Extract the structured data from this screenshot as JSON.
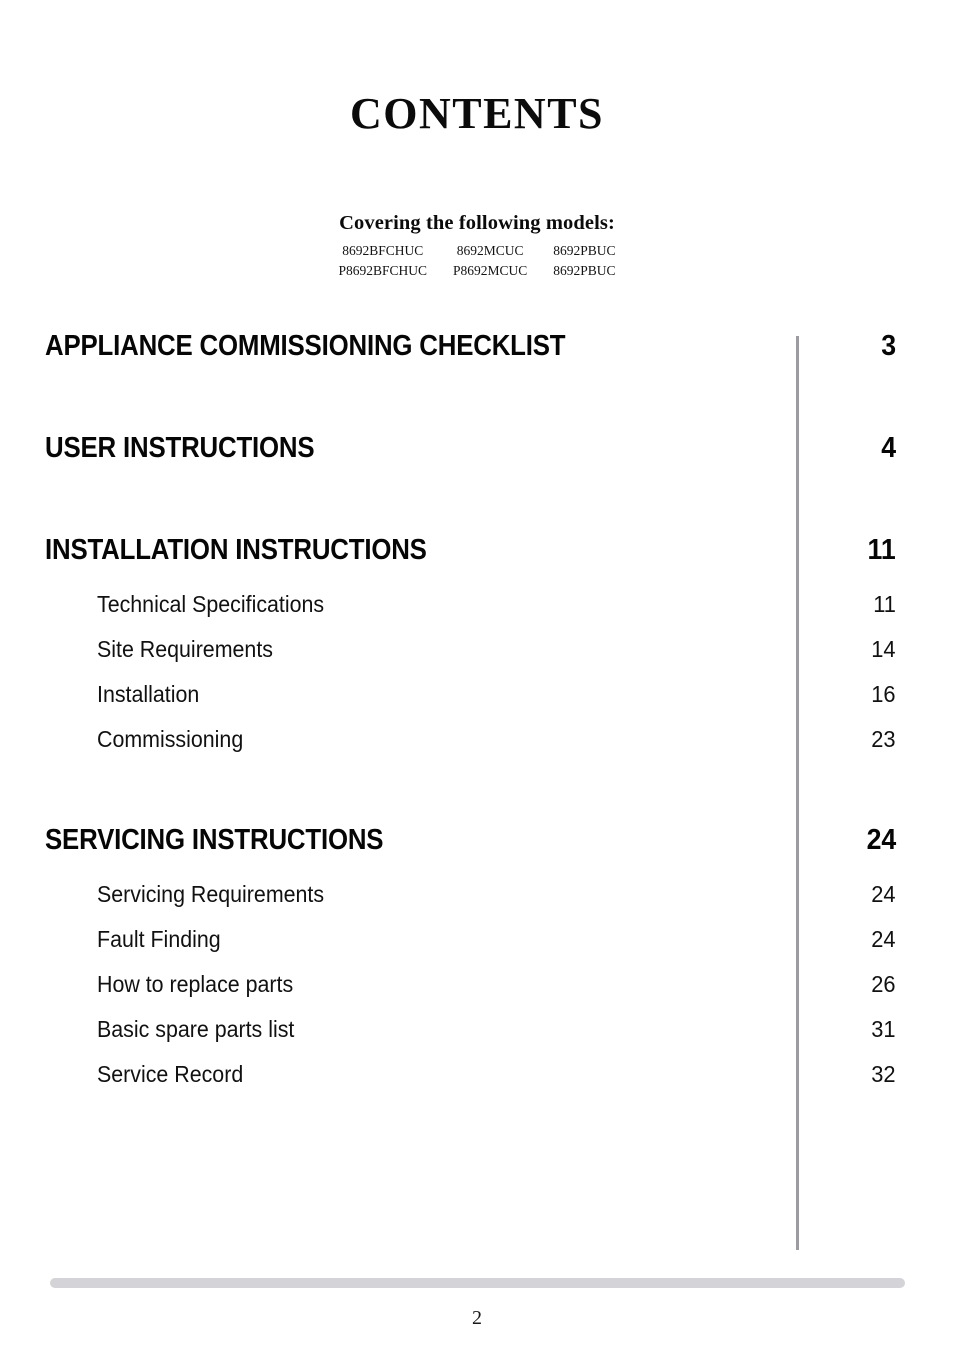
{
  "document": {
    "title": "CONTENTS",
    "footer_page_number": "2"
  },
  "models": {
    "heading": "Covering the following models:",
    "rows": [
      [
        "8692BFCHUC",
        "8692MCUC",
        "8692PBUC"
      ],
      [
        "P8692BFCHUC",
        "P8692MCUC",
        "8692PBUC"
      ]
    ]
  },
  "toc": {
    "sections": [
      {
        "label": "APPLIANCE COMMISSIONING CHECKLIST",
        "page": "3",
        "items": []
      },
      {
        "label": "USER INSTRUCTIONS",
        "page": "4",
        "items": []
      },
      {
        "label": "INSTALLATION INSTRUCTIONS",
        "page": "11",
        "items": [
          {
            "label": "Technical Specifications",
            "page": "11"
          },
          {
            "label": "Site Requirements",
            "page": "14"
          },
          {
            "label": "Installation",
            "page": "16"
          },
          {
            "label": "Commissioning",
            "page": "23"
          }
        ]
      },
      {
        "label": "SERVICING INSTRUCTIONS",
        "page": "24",
        "items": [
          {
            "label": "Servicing Requirements",
            "page": "24"
          },
          {
            "label": "Fault Finding",
            "page": "24"
          },
          {
            "label": "How to replace parts",
            "page": "26"
          },
          {
            "label": "Basic spare parts list",
            "page": "31"
          },
          {
            "label": "Service Record",
            "page": "32"
          }
        ]
      }
    ]
  },
  "colors": {
    "divider_rule": "#9b9ba0",
    "footer_bar": "#d4d4d8",
    "text": "#000000"
  }
}
